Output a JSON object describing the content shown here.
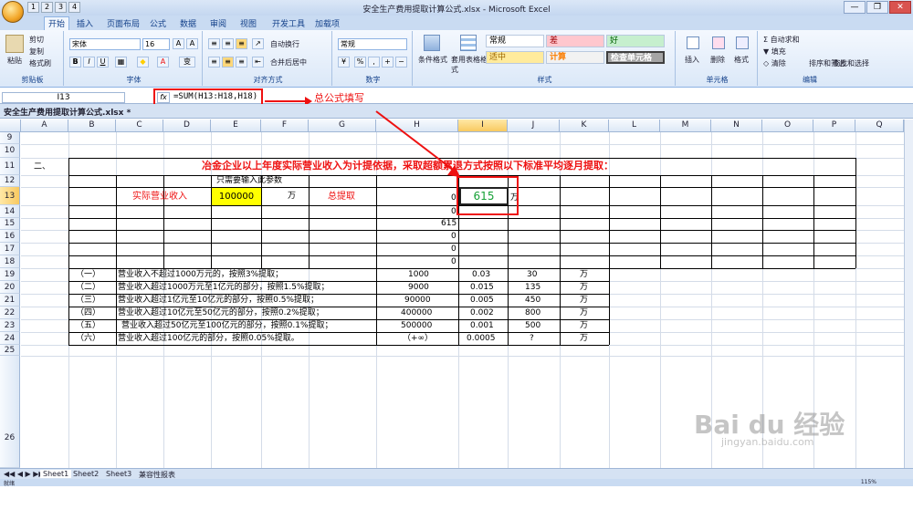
{
  "window": {
    "title": "安全生产费用提取计算公式.xlsx - Microsoft Excel",
    "qat": [
      "1",
      "2",
      "3",
      "4"
    ],
    "controls": [
      "—",
      "❐",
      "✕"
    ]
  },
  "ribbon_tabs": [
    {
      "label": "开始",
      "key": "H"
    },
    {
      "label": "插入",
      "key": "N"
    },
    {
      "label": "页面布局",
      "key": "P"
    },
    {
      "label": "公式",
      "key": "M"
    },
    {
      "label": "数据",
      "key": "A"
    },
    {
      "label": "审阅",
      "key": "R"
    },
    {
      "label": "视图",
      "key": "W"
    },
    {
      "label": "开发工具",
      "key": "L"
    },
    {
      "label": "加载项",
      "key": "X"
    }
  ],
  "ribbon": {
    "clipboard": {
      "paste": "粘贴",
      "cut": "剪切",
      "copy": "复制",
      "format_painter": "格式刷",
      "label": "剪贴板"
    },
    "font": {
      "name": "宋体",
      "size": "16",
      "grow": "A",
      "shrink": "A",
      "bold": "B",
      "italic": "I",
      "underline": "U",
      "label": "字体",
      "wen": "变"
    },
    "align": {
      "wrap": "自动换行",
      "merge": "合并后居中",
      "label": "对齐方式"
    },
    "number": {
      "format": "常规",
      "percent": "%",
      "comma": ",",
      "label": "数字"
    },
    "styles": {
      "cond": "条件格式",
      "table": "套用表格格式",
      "label": "样式",
      "cells": [
        {
          "text": "常规",
          "bg": "#ffffff",
          "fg": "#000000"
        },
        {
          "text": "差",
          "bg": "#ffc7ce",
          "fg": "#9c0006"
        },
        {
          "text": "好",
          "bg": "#c6efce",
          "fg": "#006100"
        },
        {
          "text": "适中",
          "bg": "#ffeb9c",
          "fg": "#9c6500"
        },
        {
          "text": "计算",
          "bg": "#f2f2f2",
          "fg": "#fa7d00"
        },
        {
          "text": "检查单元格",
          "bg": "#a5a5a5",
          "fg": "#ffffff"
        }
      ]
    },
    "cells": {
      "insert": "插入",
      "delete": "删除",
      "format": "格式",
      "label": "单元格"
    },
    "edit": {
      "autosum": "自动求和",
      "fill": "填充",
      "clear": "清除",
      "sort": "排序和筛选",
      "find": "查找和选择",
      "label": "编辑"
    }
  },
  "formula_bar": {
    "name_box": "I13",
    "fx": "fx",
    "formula": "=SUM(H13:H18,H18)"
  },
  "annotation": {
    "text": "总公式填写"
  },
  "workbook_tab": "安全生产费用提取计算公式.xlsx *",
  "columns": [
    "A",
    "B",
    "C",
    "D",
    "E",
    "F",
    "G",
    "H",
    "I",
    "J",
    "K",
    "L",
    "M",
    "N",
    "O",
    "P",
    "Q"
  ],
  "rows": [
    "9",
    "10",
    "11",
    "12",
    "13",
    "14",
    "15",
    "16",
    "17",
    "18",
    "19",
    "20",
    "21",
    "22",
    "23",
    "24",
    "25",
    "26"
  ],
  "sheet": {
    "b11": "二、",
    "title": "冶金企业以上年度实际营业收入为计提依据，采取超额累退方式按照以下标准平均逐月提取：",
    "e12": "只需要输入此参数",
    "c13": "实际营业收入",
    "e13": "100000",
    "f13": "万",
    "g13": "总提取",
    "h13": "0",
    "i13": "615",
    "j13": "万",
    "h14": "0",
    "h15": "615",
    "h16": "0",
    "h17": "0",
    "h18": "0",
    "tiers": [
      {
        "no": "（一）",
        "desc": "营业收入不超过1000万元的，按照3%提取；",
        "limit": "1000",
        "rate": "0.03",
        "amt": "30",
        "unit": "万"
      },
      {
        "no": "（二）",
        "desc": "营业收入超过1000万元至1亿元的部分，按照1.5%提取；",
        "limit": "9000",
        "rate": "0.015",
        "amt": "135",
        "unit": "万"
      },
      {
        "no": "（三）",
        "desc": "营业收入超过1亿元至10亿元的部分，按照0.5%提取；",
        "limit": "90000",
        "rate": "0.005",
        "amt": "450",
        "unit": "万"
      },
      {
        "no": "（四）",
        "desc": "营业收入超过10亿元至50亿元的部分，按照0.2%提取；",
        "limit": "400000",
        "rate": "0.002",
        "amt": "800",
        "unit": "万"
      },
      {
        "no": "（五）",
        "desc": "营业收入超过50亿元至100亿元的部分，按照0.1%提取；",
        "limit": "500000",
        "rate": "0.001",
        "amt": "500",
        "unit": "万"
      },
      {
        "no": "（六）",
        "desc": "营业收入超过100亿元的部分，按照0.05%提取。",
        "limit": "（+∞）",
        "rate": "0.0005",
        "amt": "?",
        "unit": "万"
      }
    ]
  },
  "sheet_tabs": [
    "Sheet1",
    "Sheet2",
    "Sheet3",
    "兼容性报表"
  ],
  "status": {
    "ready": "就绪",
    "zoom": "115%"
  },
  "watermark": {
    "brand": "Bai du 经验",
    "url": "jingyan.baidu.com"
  }
}
